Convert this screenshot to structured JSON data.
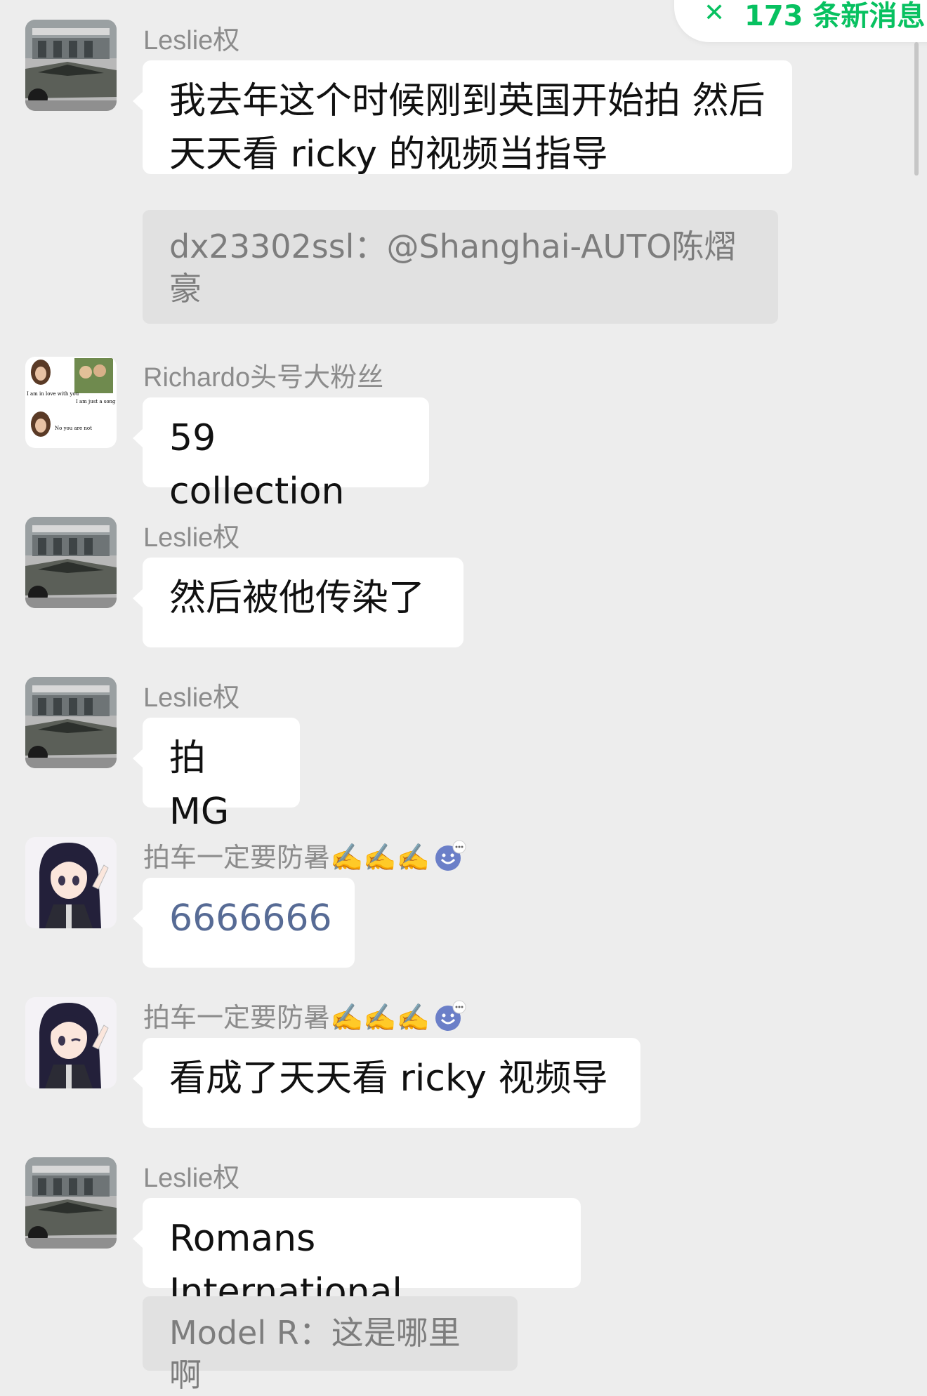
{
  "banner": {
    "new_messages": "173 条新消息"
  },
  "messages": [
    {
      "sender": "Leslie权",
      "text": "我去年这个时候刚到英国开始拍 然后天天看 ricky 的视频当指导",
      "quote": "dx23302ssl：@Shanghai-AUTO陈熠豪"
    },
    {
      "sender": "Richardo头号大粉丝",
      "text": "59 collection"
    },
    {
      "sender": "Leslie权",
      "text": "然后被他传染了"
    },
    {
      "sender": "Leslie权",
      "text": "拍 MG"
    },
    {
      "sender": "拍车一定要防暑✍️✍️✍️",
      "text": "6666666"
    },
    {
      "sender": "拍车一定要防暑✍️✍️✍️",
      "text": "看成了天天看 ricky 视频导"
    },
    {
      "sender": "Leslie权",
      "text": "Romans International",
      "quote": "Model R：这是哪里啊"
    }
  ],
  "sticker_avatar_captions": [
    "I am in love with you",
    "I am just a song",
    "No you are not"
  ]
}
